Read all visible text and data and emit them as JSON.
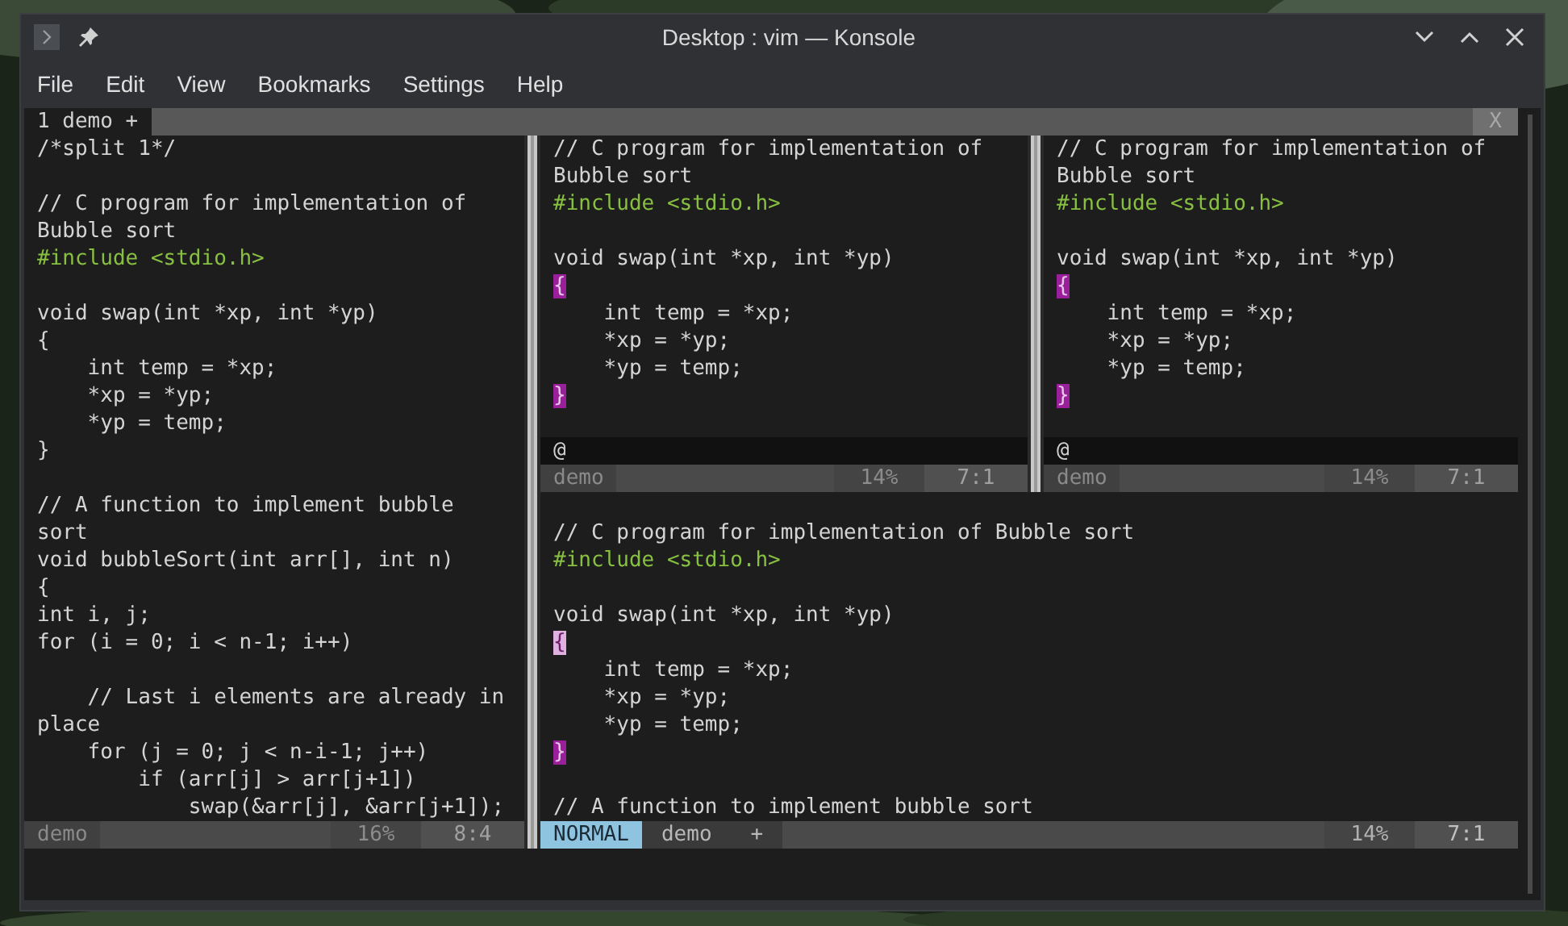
{
  "window": {
    "title": "Desktop : vim — Konsole"
  },
  "menu": [
    "File",
    "Edit",
    "View",
    "Bookmarks",
    "Settings",
    "Help"
  ],
  "tabline": {
    "tabs": [
      {
        "label": "1 demo +",
        "selected": true
      }
    ],
    "close": "X"
  },
  "left_window": {
    "lines": [
      {
        "text": "/*split 1*/",
        "kind": "text"
      },
      {
        "kind": "blank"
      },
      {
        "text": "// C program for implementation of",
        "kind": "text"
      },
      {
        "text": "Bubble sort",
        "kind": "text"
      },
      {
        "text": "#include <stdio.h>",
        "kind": "include"
      },
      {
        "kind": "blank"
      },
      {
        "text": "void swap(int *xp, int *yp)",
        "kind": "text"
      },
      {
        "text": "{",
        "kind": "text"
      },
      {
        "text": "    int temp = *xp;",
        "kind": "text"
      },
      {
        "text": "    *xp = *yp;",
        "kind": "text"
      },
      {
        "text": "    *yp = temp;",
        "kind": "text"
      },
      {
        "text": "}",
        "kind": "text"
      },
      {
        "kind": "blank"
      },
      {
        "text": "// A function to implement bubble",
        "kind": "text"
      },
      {
        "text": "sort",
        "kind": "text"
      },
      {
        "text": "void bubbleSort(int arr[], int n)",
        "kind": "text"
      },
      {
        "text": "{",
        "kind": "text"
      },
      {
        "text": "int i, j;",
        "kind": "text"
      },
      {
        "text": "for (i = 0; i < n-1; i++)",
        "kind": "text"
      },
      {
        "kind": "blank"
      },
      {
        "text": "    // Last i elements are already in",
        "kind": "text"
      },
      {
        "text": "place",
        "kind": "text"
      },
      {
        "text": "    for (j = 0; j < n-i-1; j++)",
        "kind": "text"
      },
      {
        "text": "        if (arr[j] > arr[j+1])",
        "kind": "text"
      },
      {
        "text": "            swap(&arr[j], &arr[j+1]);",
        "kind": "text"
      }
    ],
    "status": {
      "name": "demo",
      "percent": "16%",
      "position": "8:4",
      "active": false
    }
  },
  "top_windows": [
    {
      "lines": [
        {
          "text": "// C program for implementation of",
          "kind": "text"
        },
        {
          "text": "Bubble sort",
          "kind": "text"
        },
        {
          "text": "#include <stdio.h>",
          "kind": "include"
        },
        {
          "kind": "blank"
        },
        {
          "text": "void swap(int *xp, int *yp)",
          "kind": "text"
        },
        {
          "text": "{",
          "kind": "brace"
        },
        {
          "text": "    int temp = *xp;",
          "kind": "text"
        },
        {
          "text": "    *xp = *yp;",
          "kind": "text"
        },
        {
          "text": "    *yp = temp;",
          "kind": "text"
        },
        {
          "text": "}",
          "kind": "brace"
        },
        {
          "kind": "blank"
        },
        {
          "text": "@",
          "kind": "overflow"
        }
      ],
      "status": {
        "name": "demo",
        "percent": "14%",
        "position": "7:1",
        "active": false
      }
    },
    {
      "lines": [
        {
          "text": "// C program for implementation of",
          "kind": "text"
        },
        {
          "text": "Bubble sort",
          "kind": "text"
        },
        {
          "text": "#include <stdio.h>",
          "kind": "include"
        },
        {
          "kind": "blank"
        },
        {
          "text": "void swap(int *xp, int *yp)",
          "kind": "text"
        },
        {
          "text": "{",
          "kind": "brace"
        },
        {
          "text": "    int temp = *xp;",
          "kind": "text"
        },
        {
          "text": "    *xp = *yp;",
          "kind": "text"
        },
        {
          "text": "    *yp = temp;",
          "kind": "text"
        },
        {
          "text": "}",
          "kind": "brace"
        },
        {
          "kind": "blank"
        },
        {
          "text": "@",
          "kind": "overflow"
        }
      ],
      "status": {
        "name": "demo",
        "percent": "14%",
        "position": "7:1",
        "active": false
      }
    }
  ],
  "bottom_window": {
    "lines": [
      {
        "kind": "blank"
      },
      {
        "text": "// C program for implementation of Bubble sort",
        "kind": "text"
      },
      {
        "text": "#include <stdio.h>",
        "kind": "include"
      },
      {
        "kind": "blank"
      },
      {
        "text": "void swap(int *xp, int *yp)",
        "kind": "text"
      },
      {
        "text": "{",
        "kind": "match"
      },
      {
        "text": "    int temp = *xp;",
        "kind": "text"
      },
      {
        "text": "    *xp = *yp;",
        "kind": "text"
      },
      {
        "text": "    *yp = temp;",
        "kind": "text"
      },
      {
        "text": "}",
        "kind": "brace"
      },
      {
        "kind": "blank"
      },
      {
        "text": "// A function to implement bubble sort",
        "kind": "text"
      }
    ],
    "status": {
      "mode": "NORMAL",
      "name": "demo",
      "modified": "+",
      "percent": "14%",
      "position": "7:1",
      "active": true
    }
  }
}
